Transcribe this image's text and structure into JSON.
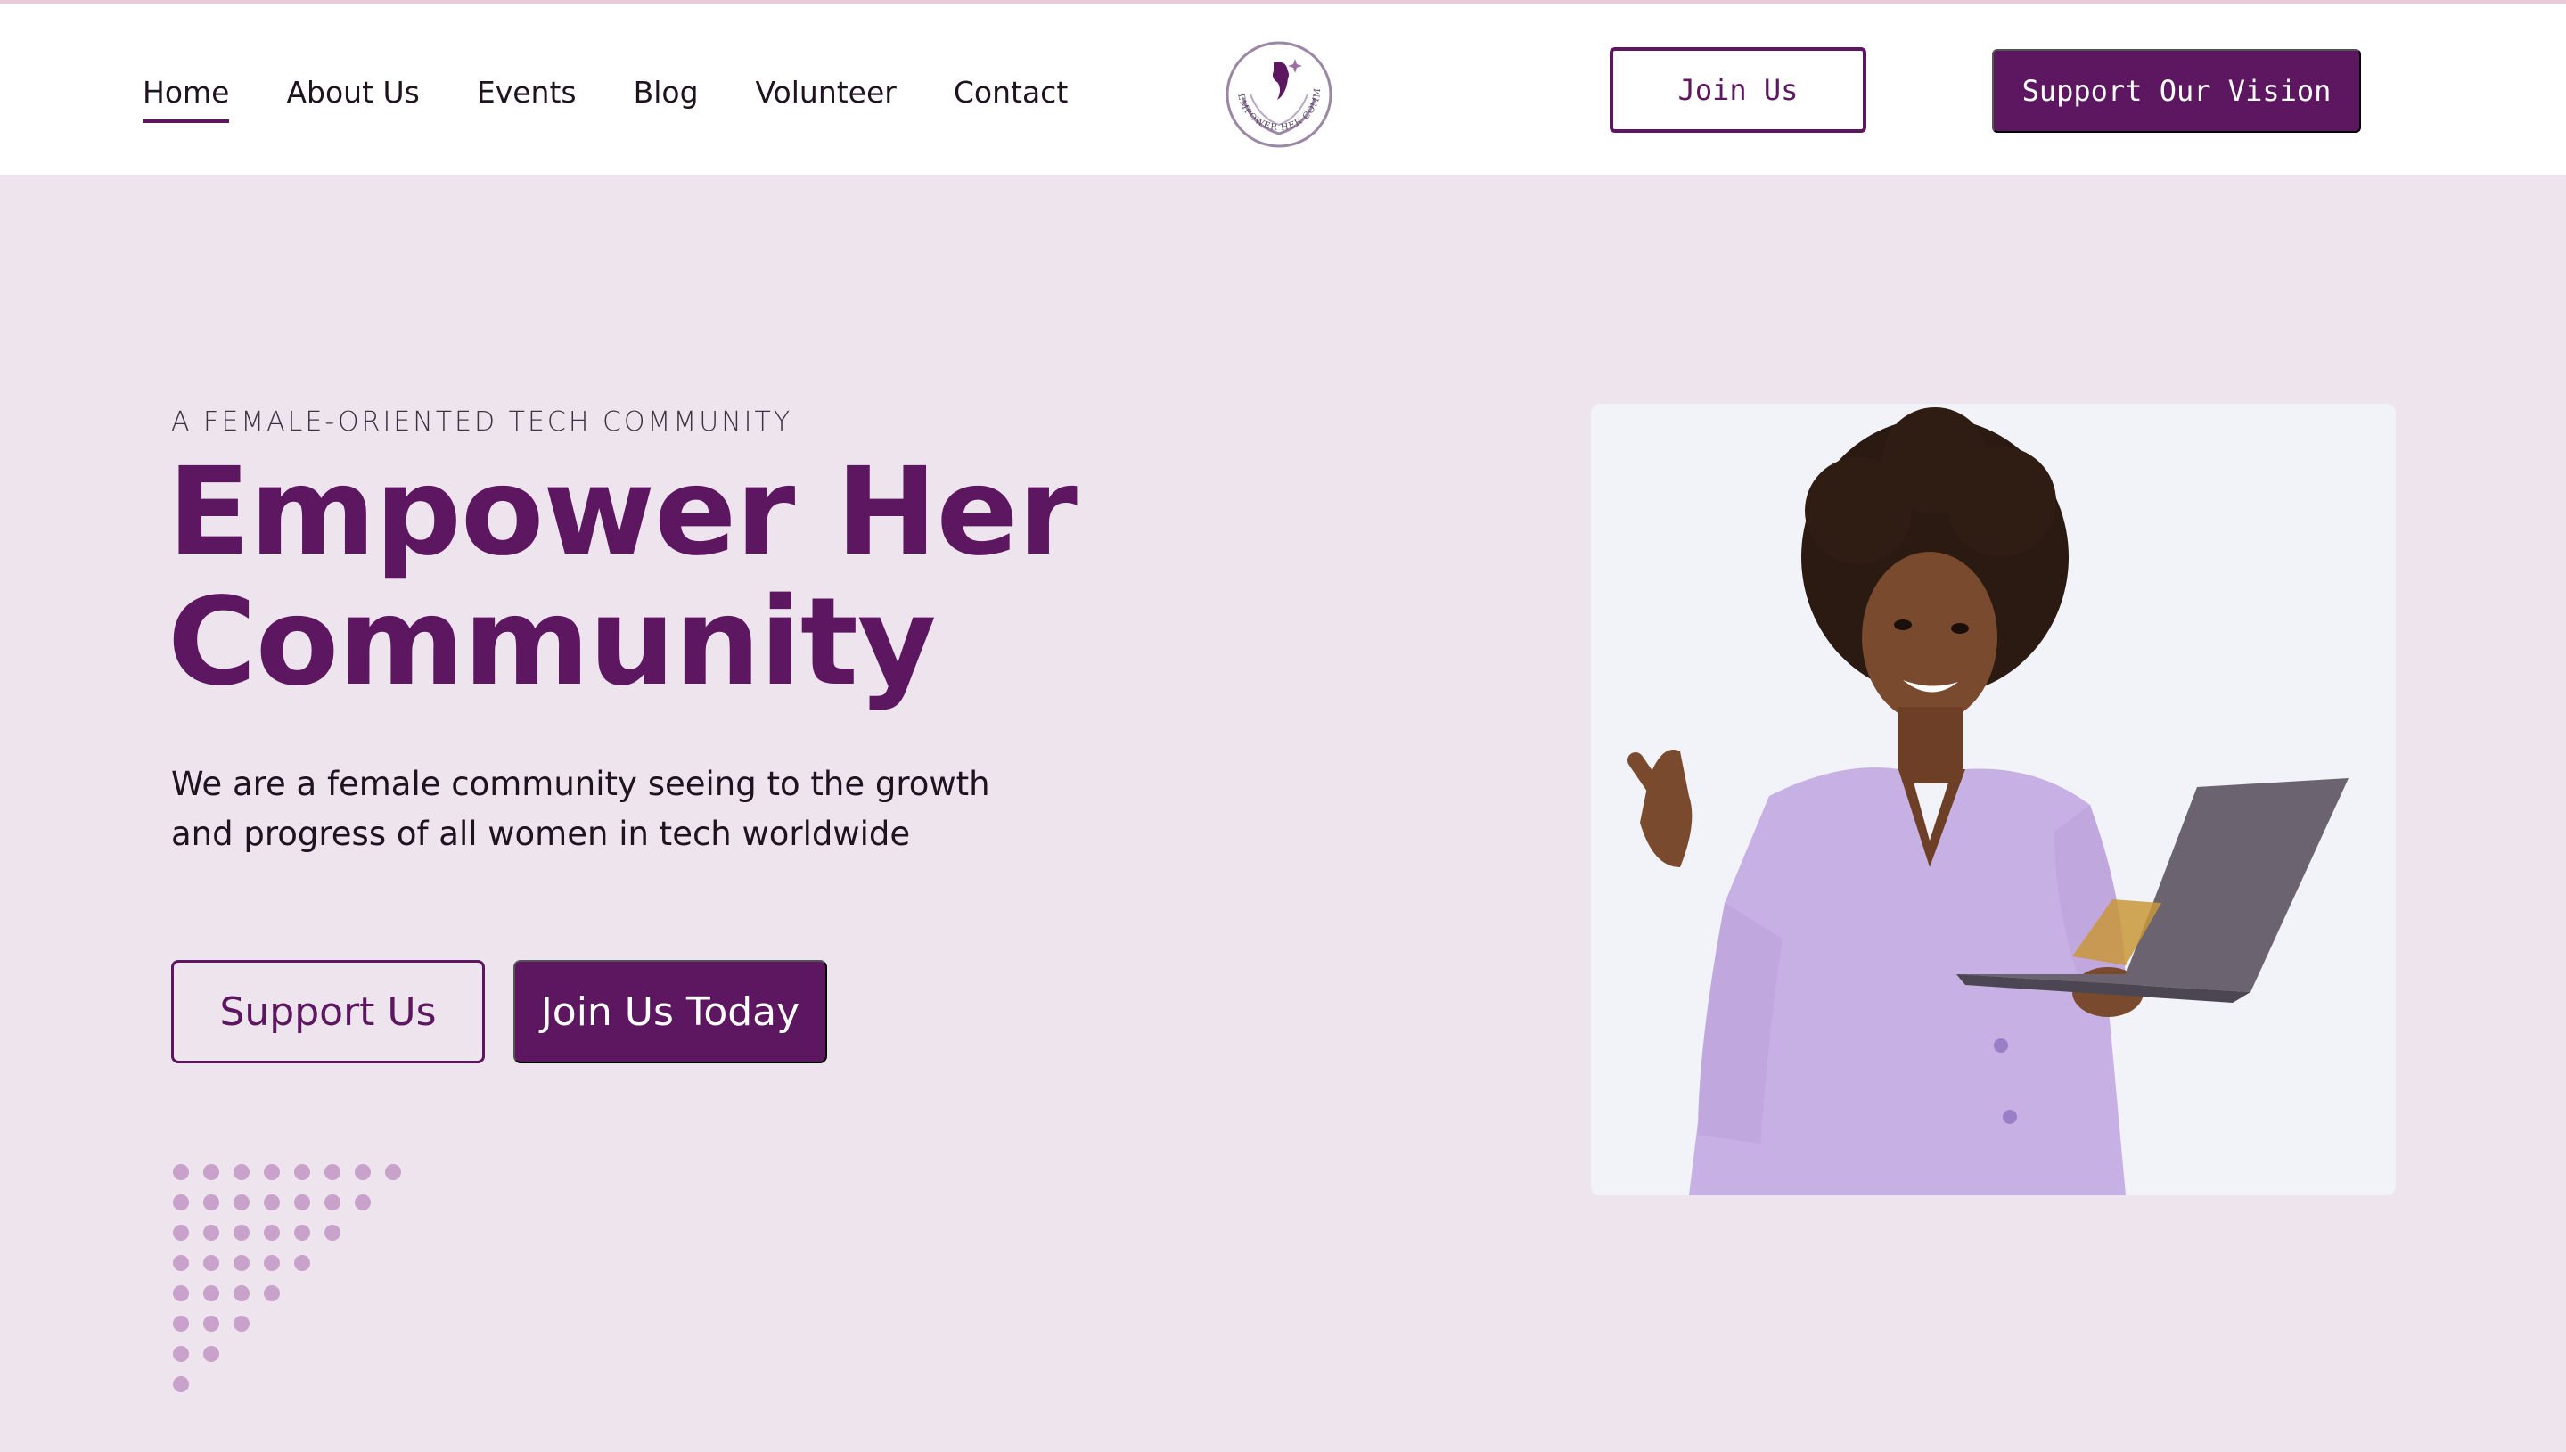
{
  "nav": {
    "items": [
      {
        "label": "Home",
        "active": true
      },
      {
        "label": "About Us",
        "active": false
      },
      {
        "label": "Events",
        "active": false
      },
      {
        "label": "Blog",
        "active": false
      },
      {
        "label": "Volunteer",
        "active": false
      },
      {
        "label": "Contact",
        "active": false
      }
    ],
    "logo_text": "EMPOWER HER COMMUNITY",
    "join_label": "Join Us",
    "support_label": "Support Our Vision"
  },
  "hero": {
    "eyebrow": "A FEMALE-ORIENTED TECH COMMUNITY",
    "title_line1": "Empower Her",
    "title_line2": "Community",
    "description": "We are a female community seeing to the growth and progress of all women in tech worldwide",
    "support_button": "Support Us",
    "join_button": "Join Us Today",
    "image_icon": "woman-with-laptop-photo"
  },
  "colors": {
    "brand": "#5d1660",
    "background": "#ede4ee",
    "header": "#ffffff",
    "dots": "#c8a2cb"
  }
}
